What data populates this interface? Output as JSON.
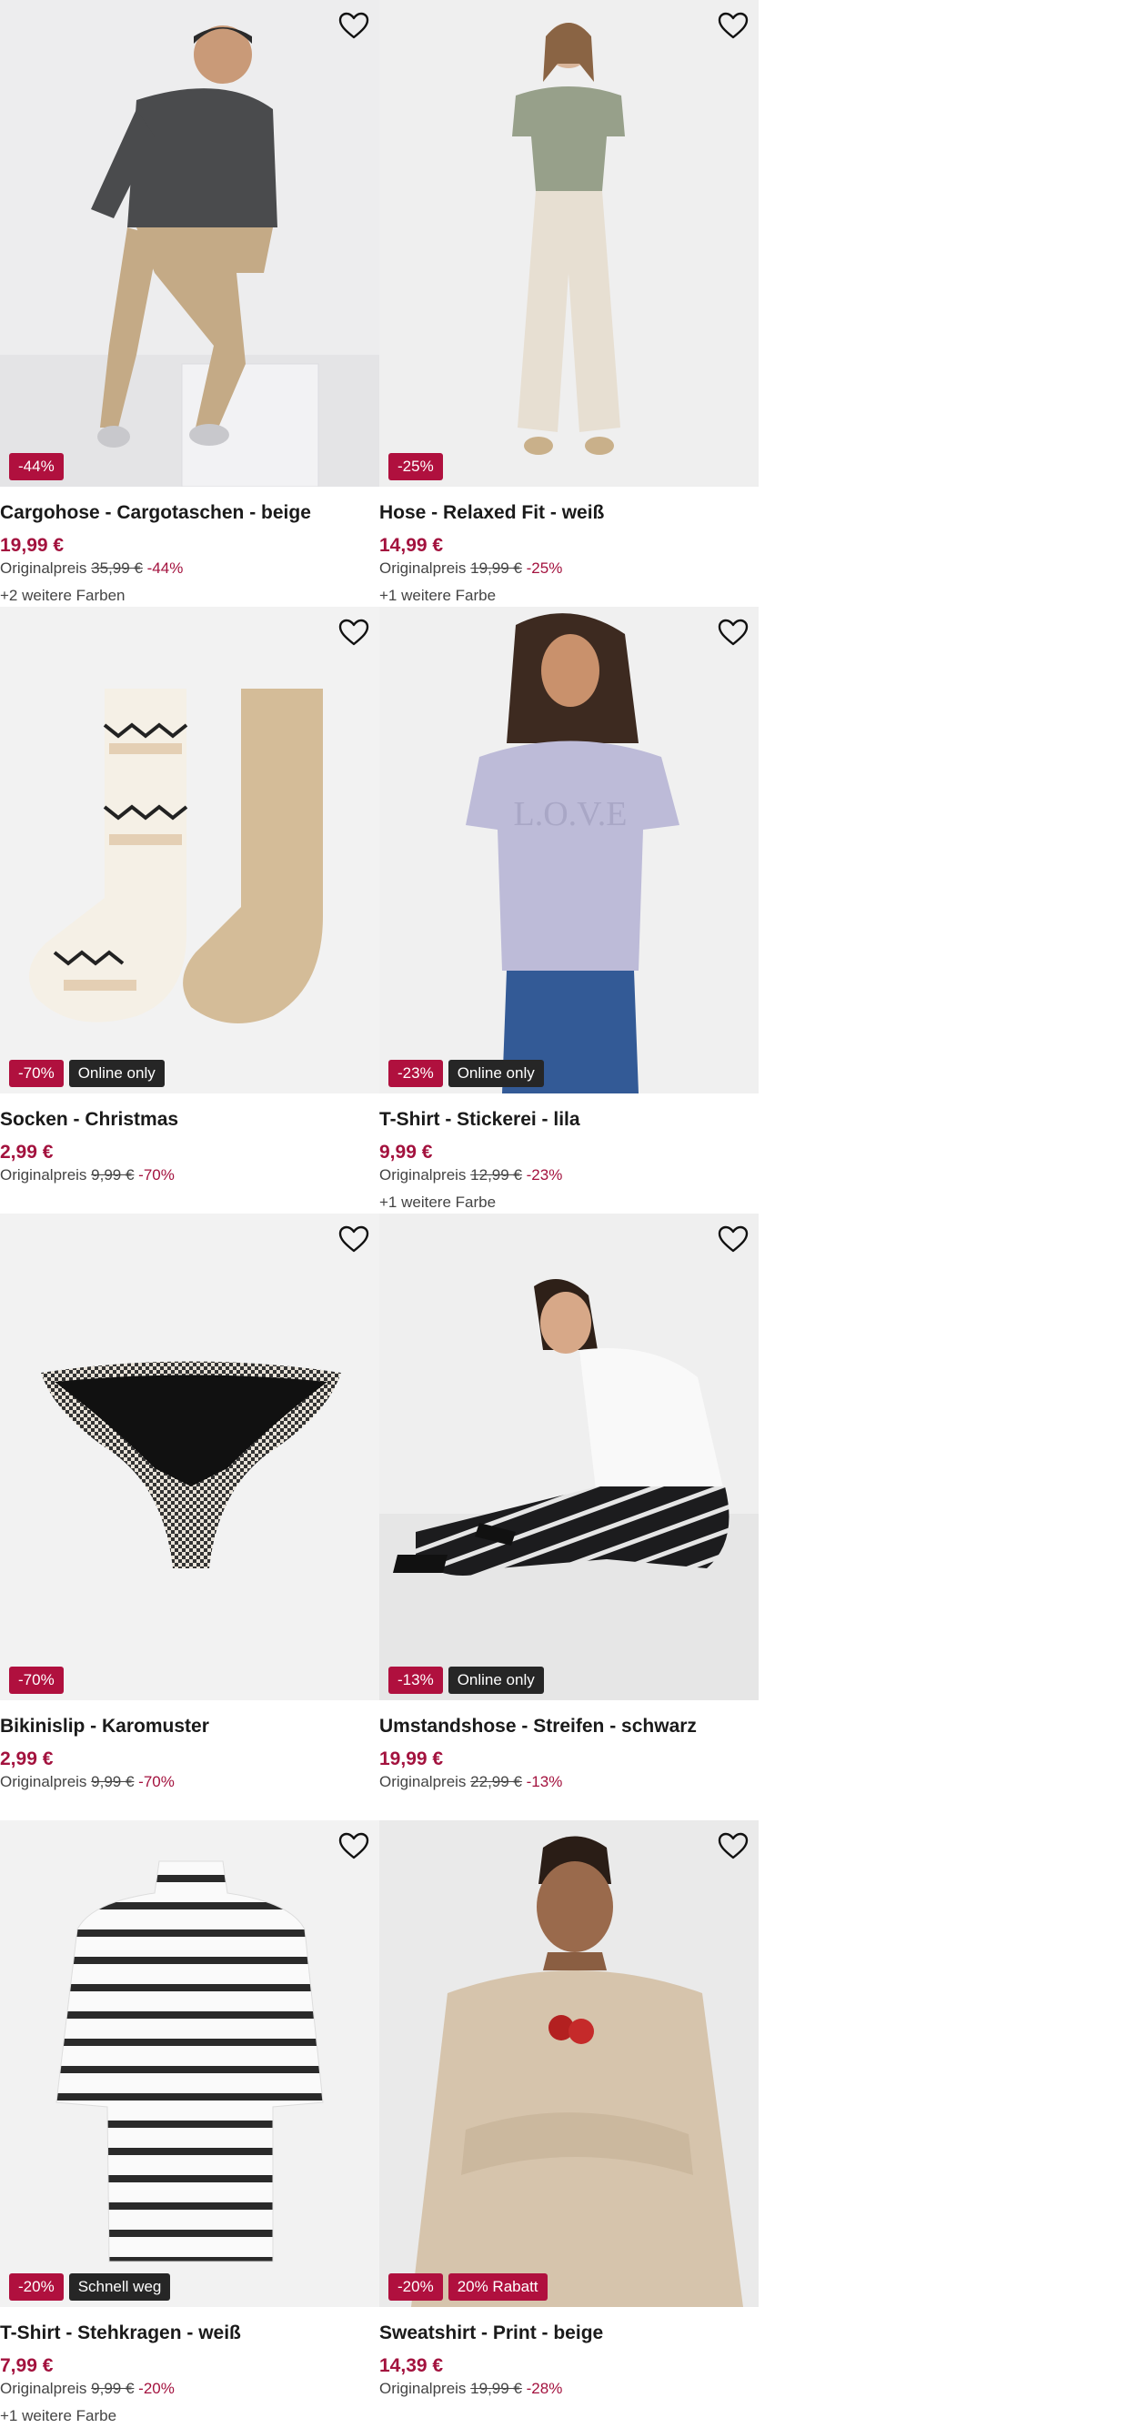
{
  "products": [
    {
      "name": "Cargohose - Cargotaschen - beige",
      "price": "19,99 €",
      "orig_label": "Originalpreis",
      "orig_price": "35,99 €",
      "discount": "-44%",
      "colors": "+2 weitere Farben",
      "badges": [
        {
          "text": "-44%",
          "type": "sale"
        }
      ],
      "illustration": "man-cargo-pants"
    },
    {
      "name": "Hose - Relaxed Fit - weiß",
      "price": "14,99 €",
      "orig_label": "Originalpreis",
      "orig_price": "19,99 €",
      "discount": "-25%",
      "colors": "+1 weitere Farbe",
      "badges": [
        {
          "text": "-25%",
          "type": "sale"
        }
      ],
      "illustration": "woman-relaxed-trousers"
    },
    {
      "name": "Socken - Christmas",
      "price": "2,99 €",
      "orig_label": "Originalpreis",
      "orig_price": "9,99 €",
      "discount": "-70%",
      "colors": "",
      "badges": [
        {
          "text": "-70%",
          "type": "sale"
        },
        {
          "text": "Online only",
          "type": "dark"
        }
      ],
      "illustration": "socks"
    },
    {
      "name": "T-Shirt - Stickerei - lila",
      "price": "9,99 €",
      "orig_label": "Originalpreis",
      "orig_price": "12,99 €",
      "discount": "-23%",
      "colors": "+1 weitere Farbe",
      "badges": [
        {
          "text": "-23%",
          "type": "sale"
        },
        {
          "text": "Online only",
          "type": "dark"
        }
      ],
      "illustration": "woman-lilac-tshirt"
    },
    {
      "name": "Bikinislip - Karomuster",
      "price": "2,99 €",
      "orig_label": "Originalpreis",
      "orig_price": "9,99 €",
      "discount": "-70%",
      "colors": "",
      "badges": [
        {
          "text": "-70%",
          "type": "sale"
        }
      ],
      "illustration": "bikini-brief"
    },
    {
      "name": "Umstandshose - Streifen - schwarz",
      "price": "19,99 €",
      "orig_label": "Originalpreis",
      "orig_price": "22,99 €",
      "discount": "-13%",
      "colors": "",
      "badges": [
        {
          "text": "-13%",
          "type": "sale"
        },
        {
          "text": "Online only",
          "type": "dark"
        }
      ],
      "illustration": "woman-striped-pants"
    },
    {
      "name": "T-Shirt - Stehkragen - weiß",
      "price": "7,99 €",
      "orig_label": "Originalpreis",
      "orig_price": "9,99 €",
      "discount": "-20%",
      "colors": "+1 weitere Farbe",
      "badges": [
        {
          "text": "-20%",
          "type": "sale"
        },
        {
          "text": "Schnell weg",
          "type": "dark"
        }
      ],
      "illustration": "striped-tshirt"
    },
    {
      "name": "Sweatshirt - Print - beige",
      "price": "14,39 €",
      "orig_label": "Originalpreis",
      "orig_price": "19,99 €",
      "discount": "-28%",
      "colors": "",
      "badges": [
        {
          "text": "-20%",
          "type": "sale"
        },
        {
          "text": "20% Rabatt",
          "type": "sale"
        }
      ],
      "illustration": "man-sweatshirt"
    }
  ],
  "icons": {
    "favorite": "heart-outline-icon"
  },
  "colors": {
    "sale": "#b0103e",
    "price": "#a3123e",
    "badge_dark": "#262626",
    "image_bg": "#f4f4f4"
  }
}
